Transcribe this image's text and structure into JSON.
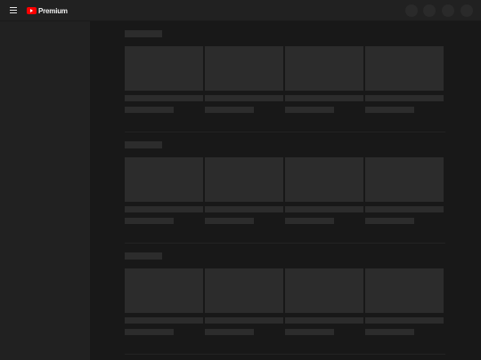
{
  "header": {
    "logo_text": "Premium",
    "colors": {
      "brand_red": "#ff0000",
      "background": "#212121"
    }
  },
  "shelves": [
    {
      "cards": [
        {},
        {},
        {},
        {}
      ]
    },
    {
      "cards": [
        {},
        {},
        {},
        {}
      ]
    },
    {
      "cards": [
        {},
        {},
        {},
        {}
      ]
    }
  ]
}
